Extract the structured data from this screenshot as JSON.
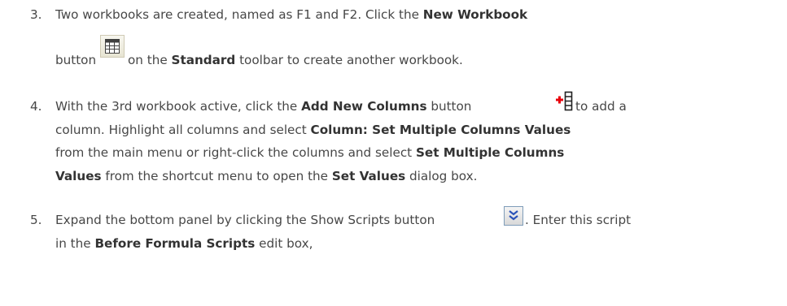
{
  "step3": {
    "number": "3.",
    "l1_a": "Two workbooks are created, named as F1 and F2. Click the ",
    "l1_b": "New Workbook",
    "l2_a": "button",
    "l2_b": "on the ",
    "l2_c": "Standard",
    "l2_d": " toolbar to create another workbook.",
    "icon": "new-workbook-icon"
  },
  "step4": {
    "number": "4.",
    "l1_a": "With the 3rd workbook active, click the ",
    "l1_b": "Add New Columns",
    "l1_c": " button ",
    "l1_d": "to add a",
    "l2_a": "column. Highlight all columns and select ",
    "l2_b": "Column: Set Multiple Columns Values",
    "l3_a": "from the main menu or right-click the columns and select ",
    "l3_b": "Set Multiple Columns",
    "l4_a": "Values",
    "l4_b": " from the shortcut menu to open the ",
    "l4_c": "Set Values",
    "l4_d": " dialog box.",
    "icon": "add-new-columns-icon"
  },
  "step5": {
    "number": "5.",
    "l1_a": "Expand the bottom panel by clicking the Show Scripts button ",
    "l1_b": ". Enter this script",
    "l2_a": "in the ",
    "l2_b": "Before Formula Scripts",
    "l2_c": " edit box,",
    "icon": "show-scripts-icon"
  }
}
